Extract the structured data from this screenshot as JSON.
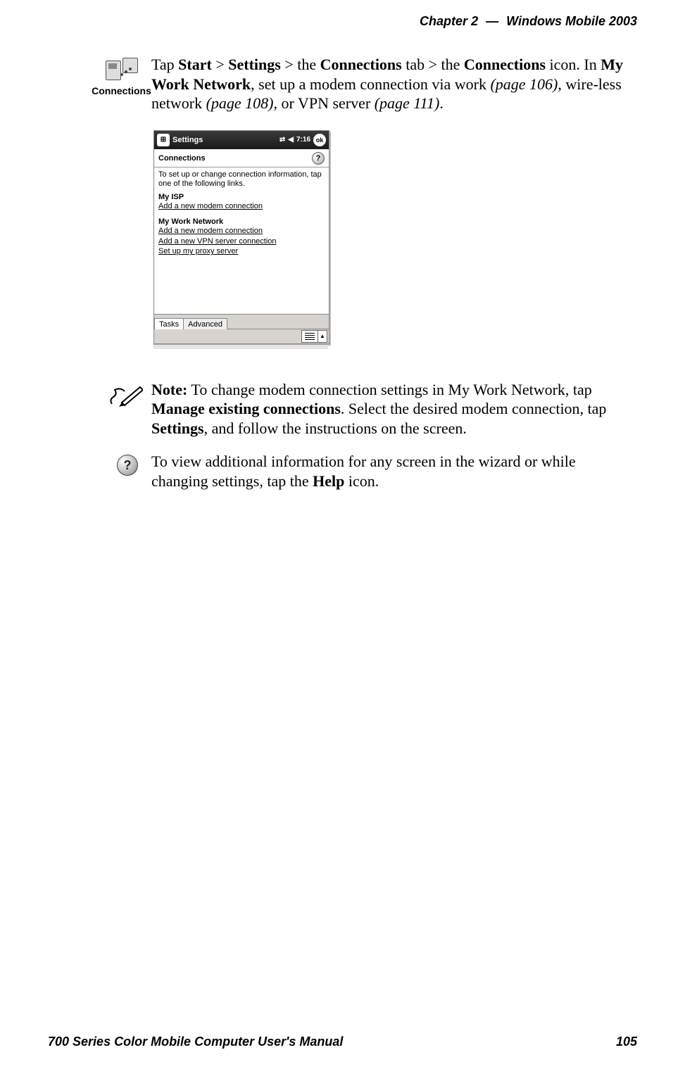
{
  "header": {
    "chapter_label": "Chapter",
    "chapter_num": "2",
    "sep": "—",
    "title": "Windows Mobile 2003"
  },
  "footer": {
    "manual": "700 Series Color Mobile Computer User's Manual",
    "page": "105"
  },
  "intro": {
    "icon_label": "Connections",
    "t1": "Tap ",
    "b1": "Start",
    "gt1": " > ",
    "b2": "Settings",
    "gt2": " > the ",
    "b3": "Connections",
    "t2": " tab > the ",
    "b4": "Connections",
    "t3": " icon. In ",
    "b5": "My Work Network",
    "t4": ", set up a modem connection via work ",
    "i1": "(page 106)",
    "t5": ", wire-less network ",
    "i2": "(page 108)",
    "t6": ", or VPN server ",
    "i3": "(page 111)",
    "t7": "."
  },
  "screenshot": {
    "titlebar": {
      "title": "Settings",
      "time": "7:16",
      "ok": "ok"
    },
    "subheader": "Connections",
    "instr": "To set up or change connection information, tap one of the following links.",
    "isp_title": "My ISP",
    "isp_link1": "Add a new modem connection",
    "work_title": "My Work Network",
    "work_link1": "Add a new modem connection",
    "work_link2": "Add a new VPN server connection",
    "work_link3": "Set up my proxy server",
    "tab1": "Tasks",
    "tab2": "Advanced"
  },
  "note": {
    "b0": "Note:",
    "t1": " To change modem connection settings in My Work Network, tap ",
    "b1": "Manage existing connections",
    "t2": ". Select the desired modem connection, tap ",
    "b2": "Settings",
    "t3": ", and follow the instructions on the screen."
  },
  "help": {
    "t1": "To view additional information for any screen in the wizard or while changing settings, tap the ",
    "b1": "Help",
    "t2": " icon."
  }
}
